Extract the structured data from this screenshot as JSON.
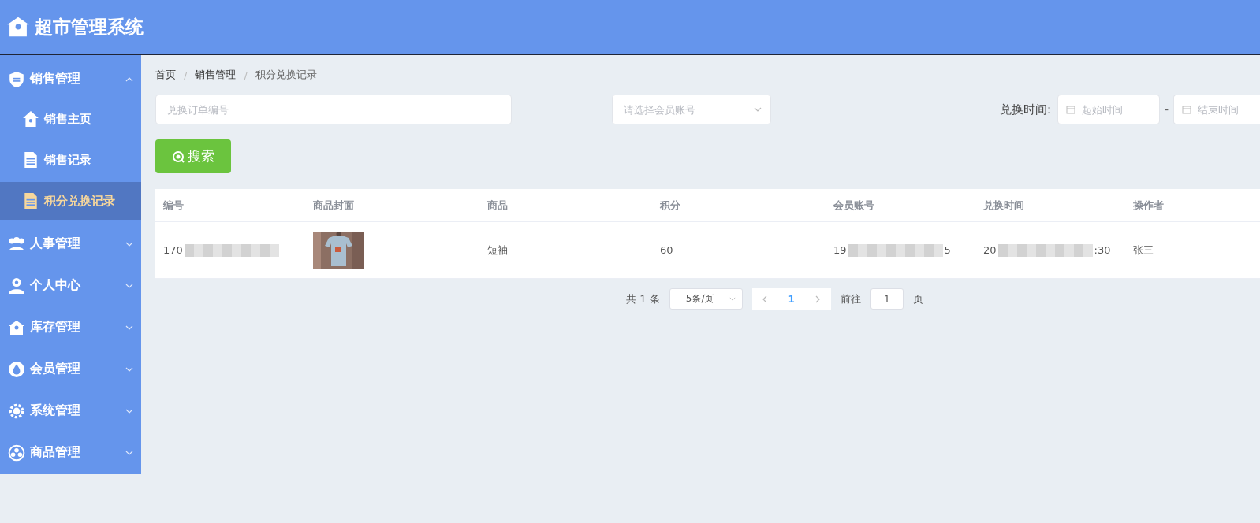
{
  "app": {
    "title": "超市管理系统"
  },
  "sidebar": {
    "items": [
      {
        "label": "销售管理",
        "expanded": true,
        "children": [
          {
            "label": "销售主页",
            "selected": false
          },
          {
            "label": "销售记录",
            "selected": false
          },
          {
            "label": "积分兑换记录",
            "selected": true
          }
        ]
      },
      {
        "label": "人事管理",
        "expanded": false
      },
      {
        "label": "个人中心",
        "expanded": false
      },
      {
        "label": "库存管理",
        "expanded": false
      },
      {
        "label": "会员管理",
        "expanded": false
      },
      {
        "label": "系统管理",
        "expanded": false
      },
      {
        "label": "商品管理",
        "expanded": false
      }
    ]
  },
  "breadcrumb": {
    "items": [
      "首页",
      "销售管理",
      "积分兑换记录"
    ],
    "separator": "/"
  },
  "filters": {
    "order_placeholder": "兑换订单编号",
    "member_placeholder": "请选择会员账号",
    "time_label": "兑换时间:",
    "start_placeholder": "起始时间",
    "separator": "-",
    "end_placeholder": "结束时间"
  },
  "search_button": "搜索",
  "table": {
    "columns": [
      "编号",
      "商品封面",
      "商品",
      "积分",
      "会员账号",
      "兑换时间",
      "操作者"
    ],
    "rows": [
      {
        "cells": [
          {
            "kind": "blurred",
            "prefix": "170"
          },
          {
            "kind": "picture"
          },
          {
            "kind": "text",
            "text": "短袖"
          },
          {
            "kind": "text",
            "text": "60"
          },
          {
            "kind": "blurred",
            "prefix": "19",
            "suffix": "5"
          },
          {
            "kind": "blurred",
            "prefix": "20",
            "suffix": ":30"
          },
          {
            "kind": "text",
            "text": "张三"
          }
        ]
      }
    ]
  },
  "pagination": {
    "total": "共 1 条",
    "page_size": "5条/页",
    "pages": [
      {
        "label": "1",
        "selected": true
      }
    ],
    "goto_label": "前往",
    "goto_value": "1",
    "goto_suffix": "页"
  }
}
